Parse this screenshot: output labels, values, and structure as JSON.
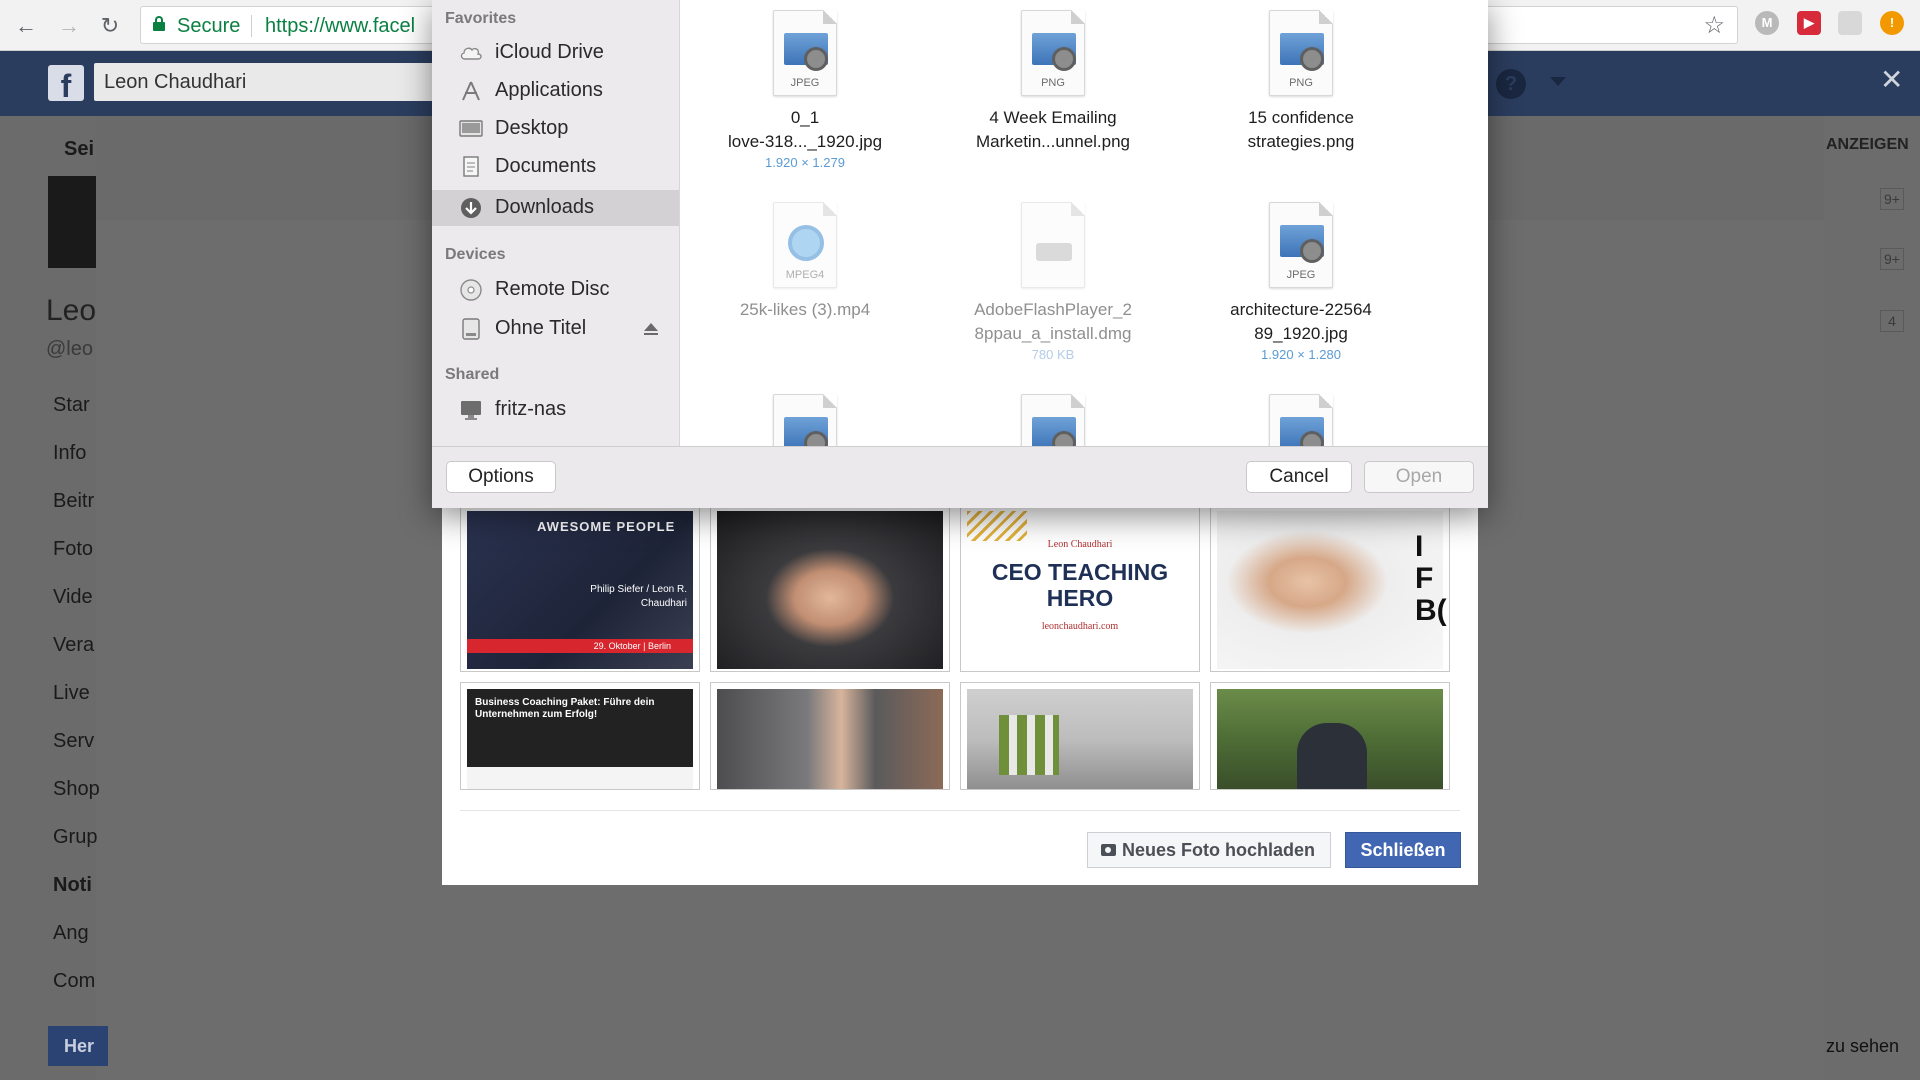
{
  "browser": {
    "secure_label": "Secure",
    "url": "https://www.facel",
    "nav": [
      "back",
      "forward",
      "reload"
    ],
    "extensions": [
      "M",
      "▶",
      "!"
    ]
  },
  "facebook": {
    "search_value": "Leon Chaudhari",
    "page_name": "Leo",
    "page_handle": "@leo",
    "top_tab": "Sei",
    "sidebar": [
      "Star",
      "Info",
      "Beitr",
      "Foto",
      "Vide",
      "Vera",
      "Live",
      "Serv",
      "Shop",
      "Grup",
      "Noti",
      "Ang",
      "Com"
    ],
    "sidebar_bold": "Noti",
    "sidebar_button": "Her",
    "right_label": "ANZEIGEN",
    "right_badges": [
      "9+",
      "9+",
      "4"
    ],
    "right_footer": "zu sehen"
  },
  "photo_dialog": {
    "photos": [
      {
        "label": "AWESOME PEOPLE",
        "sub": "Philip Siefer / Leon R. Chaudhari",
        "date": "29. Oktober | Berlin"
      },
      {
        "label": "portrait"
      },
      {
        "label_top": "Leon Chaudhari",
        "label": "CEO TEACHING HERO",
        "sub": "leonchaudhari.com"
      },
      {
        "label": "portrait-2"
      },
      {
        "label": "Business Coaching Paket: Führe dein Unternehmen zum Erfolg!"
      },
      {
        "label": "desk-portrait"
      },
      {
        "label": "workshop"
      },
      {
        "label": "outdoor"
      }
    ],
    "upload_button": "Neues Foto hochladen",
    "close_button": "Schließen"
  },
  "file_picker": {
    "sections": [
      {
        "heading": "Favorites",
        "items": [
          {
            "label": "iCloud Drive",
            "icon": "cloud-icon"
          },
          {
            "label": "Applications",
            "icon": "applications-icon"
          },
          {
            "label": "Desktop",
            "icon": "desktop-icon"
          },
          {
            "label": "Documents",
            "icon": "documents-icon"
          },
          {
            "label": "Downloads",
            "icon": "downloads-icon",
            "selected": true
          }
        ]
      },
      {
        "heading": "Devices",
        "items": [
          {
            "label": "Remote Disc",
            "icon": "disc-icon"
          },
          {
            "label": "Ohne Titel",
            "icon": "drive-icon",
            "eject": true
          }
        ]
      },
      {
        "heading": "Shared",
        "items": [
          {
            "label": "fritz-nas",
            "icon": "monitor-icon"
          }
        ]
      }
    ],
    "files": [
      {
        "type": "JPEG",
        "name1": "0_1",
        "name2": "love-318..._1920.jpg",
        "meta": "1.920 × 1.279",
        "dim": false
      },
      {
        "type": "PNG",
        "name1": "4 Week Emailing",
        "name2": "Marketin...unnel.png",
        "meta": "",
        "dim": false
      },
      {
        "type": "PNG",
        "name1": "15 confidence",
        "name2": "strategies.png",
        "meta": "",
        "dim": false
      },
      {
        "type": "MPEG4",
        "name1": "25k-likes (3).mp4",
        "name2": "",
        "meta": "",
        "dim": true
      },
      {
        "type": "",
        "name1": "AdobeFlashPlayer_2",
        "name2": "8ppau_a_install.dmg",
        "meta": "780 KB",
        "dim": true
      },
      {
        "type": "JPEG",
        "name1": "architecture-22564",
        "name2": "89_1920.jpg",
        "meta": "1.920 × 1.280",
        "dim": false
      }
    ],
    "options_button": "Options",
    "cancel_button": "Cancel",
    "open_button": "Open"
  }
}
